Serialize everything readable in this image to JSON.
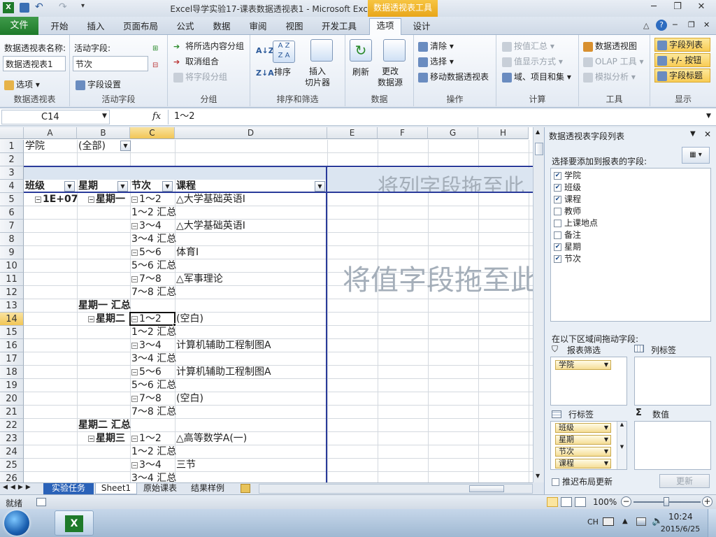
{
  "window": {
    "title": "Excel导学实验17-课表数据透视表1  -  Microsoft Excel",
    "context_tab": "数据透视表工具"
  },
  "tabs": [
    "文件",
    "开始",
    "插入",
    "页面布局",
    "公式",
    "数据",
    "审阅",
    "视图",
    "开发工具",
    "选项",
    "设计"
  ],
  "ribbon": {
    "pivottable": {
      "name_label": "数据透视表名称:",
      "name_value": "数据透视表1",
      "options": "选项",
      "group": "数据透视表"
    },
    "activefield": {
      "label": "活动字段:",
      "value": "节次",
      "settings": "字段设置",
      "group": "活动字段"
    },
    "grouping": {
      "selection": "将所选内容分组",
      "ungroup": "取消组合",
      "field": "将字段分组",
      "group": "分组"
    },
    "sort": {
      "sort": "排序",
      "slicer": "插入\n切片器",
      "group": "排序和筛选"
    },
    "data": {
      "refresh": "刷新",
      "change": "更改\n数据源",
      "group": "数据"
    },
    "actions": {
      "clear": "清除",
      "select": "选择",
      "move": "移动数据透视表",
      "group": "操作"
    },
    "calc": {
      "summarize": "按值汇总",
      "show": "值显示方式",
      "fields": "域、项目和集",
      "group": "计算"
    },
    "tools": {
      "chart": "数据透视图",
      "olap": "OLAP 工具",
      "whatif": "模拟分析",
      "group": "工具"
    },
    "show": {
      "fieldlist": "字段列表",
      "buttons": "+/- 按钮",
      "headers": "字段标题",
      "group": "显示"
    }
  },
  "formula": {
    "namebox": "C14",
    "fx": "fx",
    "content": "1～2"
  },
  "columns": [
    "A",
    "B",
    "C",
    "D",
    "E",
    "F",
    "G",
    "H"
  ],
  "rows": [
    {
      "n": "1",
      "a": "学院",
      "b": "(全部)",
      "c": "",
      "d": ""
    },
    {
      "n": "2",
      "a": "",
      "b": "",
      "c": "",
      "d": ""
    },
    {
      "n": "3",
      "a": "",
      "b": "",
      "c": "",
      "d": ""
    },
    {
      "n": "4",
      "a": "班级",
      "b": "星期",
      "c": "节次",
      "d": "课程"
    },
    {
      "n": "5",
      "a": "1E+07",
      "b": "星期一",
      "c": "1～2",
      "d": "△大学基础英语Ⅰ"
    },
    {
      "n": "6",
      "a": "",
      "b": "",
      "c": "1～2 汇总",
      "d": ""
    },
    {
      "n": "7",
      "a": "",
      "b": "",
      "c": "3～4",
      "d": "△大学基础英语Ⅰ"
    },
    {
      "n": "8",
      "a": "",
      "b": "",
      "c": "3～4 汇总",
      "d": ""
    },
    {
      "n": "9",
      "a": "",
      "b": "",
      "c": "5～6",
      "d": "体育Ⅰ"
    },
    {
      "n": "10",
      "a": "",
      "b": "",
      "c": "5～6 汇总",
      "d": ""
    },
    {
      "n": "11",
      "a": "",
      "b": "",
      "c": "7～8",
      "d": "△军事理论"
    },
    {
      "n": "12",
      "a": "",
      "b": "",
      "c": "7～8 汇总",
      "d": ""
    },
    {
      "n": "13",
      "a": "",
      "b": "星期一 汇总",
      "c": "",
      "d": ""
    },
    {
      "n": "14",
      "a": "",
      "b": "星期二",
      "c": "1～2",
      "d": "(空白)"
    },
    {
      "n": "15",
      "a": "",
      "b": "",
      "c": "1～2 汇总",
      "d": ""
    },
    {
      "n": "16",
      "a": "",
      "b": "",
      "c": "3～4",
      "d": "计算机辅助工程制图A"
    },
    {
      "n": "17",
      "a": "",
      "b": "",
      "c": "3～4 汇总",
      "d": ""
    },
    {
      "n": "18",
      "a": "",
      "b": "",
      "c": "5～6",
      "d": "计算机辅助工程制图A"
    },
    {
      "n": "19",
      "a": "",
      "b": "",
      "c": "5～6 汇总",
      "d": ""
    },
    {
      "n": "20",
      "a": "",
      "b": "",
      "c": "7～8",
      "d": "(空白)"
    },
    {
      "n": "21",
      "a": "",
      "b": "",
      "c": "7～8 汇总",
      "d": ""
    },
    {
      "n": "22",
      "a": "",
      "b": "星期二 汇总",
      "c": "",
      "d": ""
    },
    {
      "n": "23",
      "a": "",
      "b": "星期三",
      "c": "1～2",
      "d": "△高等数学A(一)"
    },
    {
      "n": "24",
      "a": "",
      "b": "",
      "c": "1～2 汇总",
      "d": ""
    },
    {
      "n": "25",
      "a": "",
      "b": "",
      "c": "3～4",
      "d": "三节"
    },
    {
      "n": "26",
      "a": "",
      "b": "",
      "c": "3～4 汇总",
      "d": ""
    }
  ],
  "pivot_hints": {
    "column_drop": "将列字段拖至此",
    "value_drop": "将值字段拖至此"
  },
  "sheet_tabs": [
    "实验任务",
    "Sheet1",
    "原始课表",
    "结果样例"
  ],
  "pane": {
    "title": "数据透视表字段列表",
    "choose": "选择要添加到报表的字段:",
    "fields": [
      {
        "label": "学院",
        "checked": true
      },
      {
        "label": "班级",
        "checked": true
      },
      {
        "label": "课程",
        "checked": true
      },
      {
        "label": "教师",
        "checked": false
      },
      {
        "label": "上课地点",
        "checked": false
      },
      {
        "label": "备注",
        "checked": false
      },
      {
        "label": "星期",
        "checked": true
      },
      {
        "label": "节次",
        "checked": true
      }
    ],
    "drag_label": "在以下区域间拖动字段:",
    "filter_label": "报表筛选",
    "column_label": "列标签",
    "row_label": "行标签",
    "values_label": "数值",
    "filter_items": [
      "学院"
    ],
    "row_items": [
      "班级",
      "星期",
      "节次",
      "课程"
    ],
    "defer": "推迟布局更新",
    "update": "更新"
  },
  "status": {
    "ready": "就绪",
    "zoom": "100%"
  },
  "tray": {
    "lang": "CH",
    "time": "10:24",
    "date": "2015/6/25"
  }
}
